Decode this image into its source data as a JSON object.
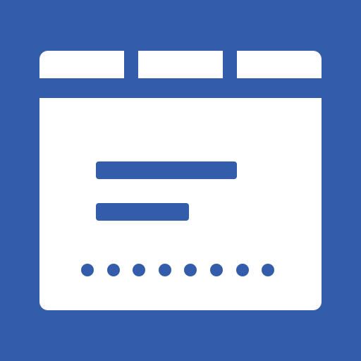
{
  "icon": {
    "name": "browser-window-form-icon",
    "background_color": "#335DAA",
    "foreground_color": "#FFFFFF",
    "accent_color": "#335DAA"
  },
  "tabs": [
    {
      "name": "tab"
    },
    {
      "name": "tab"
    },
    {
      "name": "tab"
    }
  ],
  "content_lines": [
    {
      "name": "text-line-long"
    },
    {
      "name": "text-line-short"
    }
  ],
  "password_dots": {
    "count": 8
  }
}
